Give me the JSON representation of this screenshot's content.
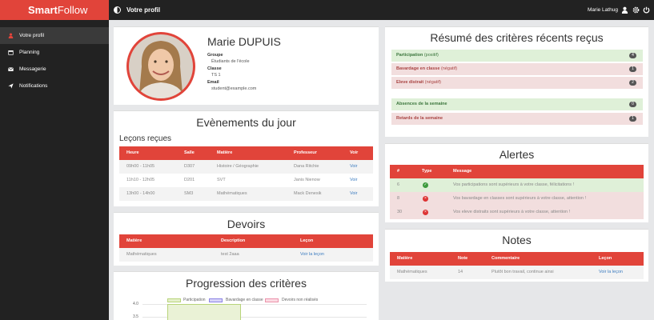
{
  "app": {
    "brand_bold": "Smart",
    "brand_light": "Follow",
    "page_title": "Votre profil",
    "user_name": "Marie Lathug"
  },
  "sidebar": {
    "items": [
      {
        "label": "Votre profil",
        "icon": "user-icon"
      },
      {
        "label": "Planning",
        "icon": "calendar-icon"
      },
      {
        "label": "Messagerie",
        "icon": "envelope-icon"
      },
      {
        "label": "Notifications",
        "icon": "send-icon"
      }
    ]
  },
  "profile": {
    "name": "Marie DUPUIS",
    "groupe_label": "Groupe",
    "groupe_value": "Étudiants de l'école",
    "classe_label": "Classe",
    "classe_value": "TS 1",
    "email_label": "Email",
    "email_value": "student@example.com"
  },
  "events": {
    "title": "Evènements du jour",
    "subtitle": "Leçons reçues",
    "headers": [
      "Heure",
      "Salle",
      "Matière",
      "Professeur",
      "Voir"
    ],
    "rows": [
      [
        "09h00 - 11h05",
        "D307",
        "Histoire / Géographie",
        "Dana Ritchie",
        "Voir"
      ],
      [
        "11h10 - 12h05",
        "D201",
        "SVT",
        "Janis Nienow",
        "Voir"
      ],
      [
        "13h00 - 14h00",
        "SM3",
        "Mathématiques",
        "Mack Denesik",
        "Voir"
      ]
    ]
  },
  "devoirs": {
    "title": "Devoirs",
    "headers": [
      "Matière",
      "Description",
      "Leçon"
    ],
    "rows": [
      [
        "Mathématiques",
        "test 2aaa",
        "Voir la leçon"
      ]
    ]
  },
  "progression": {
    "title": "Progression des critères",
    "legend": [
      "Participation",
      "Bavardage en classe",
      "Devoirs non réalisés"
    ],
    "colors": [
      "#d5e8a8",
      "#b9b4f0",
      "#f5b8c8"
    ]
  },
  "chart_data": {
    "type": "bar",
    "title": "Progression des critères",
    "series": [
      {
        "name": "Participation",
        "values": [
          4
        ]
      },
      {
        "name": "Bavardage en classe",
        "values": []
      },
      {
        "name": "Devoirs non réalisés",
        "values": []
      }
    ],
    "yticks": [
      "4.0",
      "3.5"
    ]
  },
  "criteria": {
    "title": "Résumé des critères récents reçus",
    "group1": [
      {
        "label": "Participation",
        "suffix": " (positif)",
        "count": "4",
        "type": "green"
      },
      {
        "label": "Bavardage en classe",
        "suffix": " (négatif)",
        "count": "1",
        "type": "red"
      },
      {
        "label": "Eleve distrait",
        "suffix": " (négatif)",
        "count": "2",
        "type": "red"
      }
    ],
    "group2": [
      {
        "label": "Absences de la semaine",
        "count": "0",
        "type": "green"
      },
      {
        "label": "Retards de la semaine",
        "count": "1",
        "type": "red"
      }
    ]
  },
  "alertes": {
    "title": "Alertes",
    "headers": [
      "#",
      "Type",
      "Message"
    ],
    "rows": [
      {
        "id": "6",
        "type": "ok",
        "message": "Vos participations sont supérieurs à votre classe, félicitations !"
      },
      {
        "id": "8",
        "type": "bad",
        "message": "Vos bavardage en classes sont supérieurs à votre classe, attention !"
      },
      {
        "id": "30",
        "type": "bad",
        "message": "Vos eleve distraits sont supérieurs à votre classe, attention !"
      }
    ]
  },
  "notes": {
    "title": "Notes",
    "headers": [
      "Matière",
      "Note",
      "Commentaire",
      "Leçon"
    ],
    "rows": [
      [
        "Mathématiques",
        "14",
        "Plutôt bon travail, continue ainsi",
        "Voir la leçon"
      ]
    ]
  }
}
